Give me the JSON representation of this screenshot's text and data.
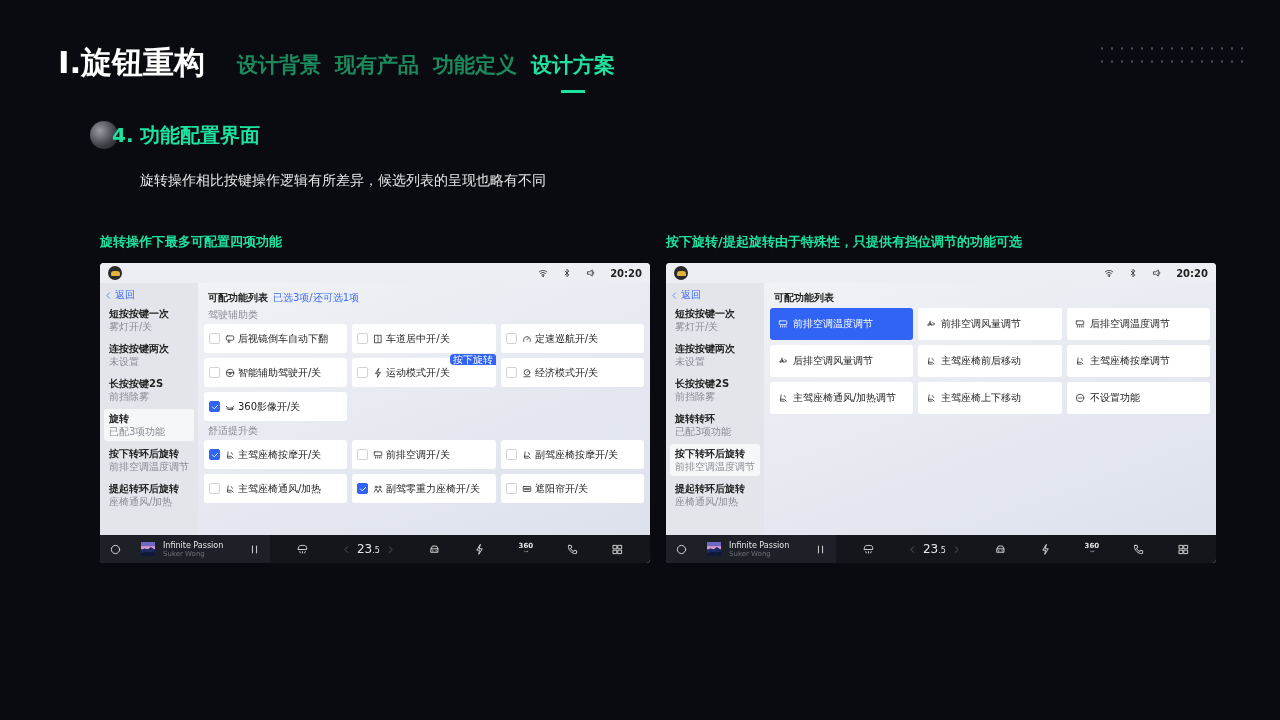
{
  "header": {
    "title": "I.旋钮重构",
    "tabs": [
      {
        "label": "设计背景",
        "selected": false
      },
      {
        "label": "现有产品",
        "selected": false
      },
      {
        "label": "功能定义",
        "selected": false
      },
      {
        "label": "设计方案",
        "selected": true
      }
    ]
  },
  "section": {
    "title": "4. 功能配置界面",
    "description": "旋转操作相比按键操作逻辑有所差异，候选列表的呈现也略有不同"
  },
  "panels": [
    {
      "caption": "旋转操作下最多可配置四项功能",
      "screen": {
        "status_bar": {
          "time": "20:20"
        },
        "back_label": "返回",
        "sidebar": [
          {
            "title": "短按按键一次",
            "subtitle": "雾灯开/关",
            "selected": false
          },
          {
            "title": "连按按键两次",
            "subtitle": "未设置",
            "selected": false
          },
          {
            "title": "长按按键2S",
            "subtitle": "前挡除雾",
            "selected": false
          },
          {
            "title": "旋转",
            "subtitle": "已配3项功能",
            "selected": true
          },
          {
            "title": "按下转环后旋转",
            "subtitle": "前排空调温度调节",
            "selected": false
          },
          {
            "title": "提起转环后旋转",
            "subtitle": "座椅通风/加热",
            "selected": false
          }
        ],
        "content": {
          "title": "可配功能列表",
          "hint": "已选3项/还可选1项",
          "groups": [
            {
              "label": "驾驶辅助类",
              "items": [
                {
                  "kind": "checkbox",
                  "label": "后视镜倒车自动下翻",
                  "checked": false
                },
                {
                  "kind": "checkbox",
                  "label": "车道居中开/关",
                  "checked": false
                },
                {
                  "kind": "checkbox",
                  "label": "定速巡航开/关",
                  "checked": false
                },
                {
                  "kind": "checkbox",
                  "label": "智能辅助驾驶开/关",
                  "checked": false
                },
                {
                  "kind": "checkbox",
                  "label": "运动模式开/关",
                  "checked": false,
                  "badge": "按下旋转"
                },
                {
                  "kind": "checkbox",
                  "label": "经济模式开/关",
                  "checked": false
                },
                {
                  "kind": "checkbox",
                  "label": "360影像开/关",
                  "checked": true
                }
              ]
            },
            {
              "label": "舒适提升类",
              "items": [
                {
                  "kind": "checkbox",
                  "label": "主驾座椅按摩开/关",
                  "checked": true
                },
                {
                  "kind": "checkbox",
                  "label": "前排空调开/关",
                  "checked": false
                },
                {
                  "kind": "checkbox",
                  "label": "副驾座椅按摩开/关",
                  "checked": false
                },
                {
                  "kind": "checkbox",
                  "label": "主驾座椅通风/加热",
                  "checked": false
                },
                {
                  "kind": "checkbox",
                  "label": "副驾零重力座椅开/关",
                  "checked": true
                },
                {
                  "kind": "checkbox",
                  "label": "遮阳帘开/关",
                  "checked": false
                }
              ]
            }
          ]
        },
        "dock": {
          "track_title": "Infinite Passion",
          "artist": "Suker Wong",
          "temperature": "23$_{.5}$",
          "view_label": "360"
        }
      }
    },
    {
      "caption": "按下旋转/提起旋转由于特殊性，只提供有挡位调节的功能可选",
      "screen": {
        "status_bar": {
          "time": "20:20"
        },
        "back_label": "返回",
        "sidebar": [
          {
            "title": "短按按键一次",
            "subtitle": "雾灯开/关",
            "selected": false
          },
          {
            "title": "连按按键两次",
            "subtitle": "未设置",
            "selected": false
          },
          {
            "title": "长按按键2S",
            "subtitle": "前挡除雾",
            "selected": false
          },
          {
            "title": "旋转转环",
            "subtitle": "已配3项功能",
            "selected": false
          },
          {
            "title": "按下转环后旋转",
            "subtitle": "前排空调温度调节",
            "selected": true
          },
          {
            "title": "提起转环后旋转",
            "subtitle": "座椅通风/加热",
            "selected": false
          }
        ],
        "content": {
          "title": "可配功能列表",
          "groups": [
            {
              "items": [
                {
                  "kind": "option",
                  "label": "前排空调温度调节",
                  "selected": true
                },
                {
                  "kind": "option",
                  "label": "前排空调风量调节",
                  "selected": false
                },
                {
                  "kind": "option",
                  "label": "后排空调温度调节",
                  "selected": false
                },
                {
                  "kind": "option",
                  "label": "后排空调风量调节",
                  "selected": false
                },
                {
                  "kind": "option",
                  "label": "主驾座椅前后移动",
                  "selected": false
                },
                {
                  "kind": "option",
                  "label": "主驾座椅按摩调节",
                  "selected": false
                },
                {
                  "kind": "option",
                  "label": "主驾座椅通风/加热调节",
                  "selected": false
                },
                {
                  "kind": "option",
                  "label": "主驾座椅上下移动",
                  "selected": false
                },
                {
                  "kind": "option",
                  "label": "不设置功能",
                  "selected": false
                }
              ]
            }
          ]
        },
        "dock": {
          "track_title": "Infinite Passion",
          "artist": "Suker Wong",
          "temperature": "23$_{.5}$",
          "view_label": "360"
        }
      }
    }
  ]
}
